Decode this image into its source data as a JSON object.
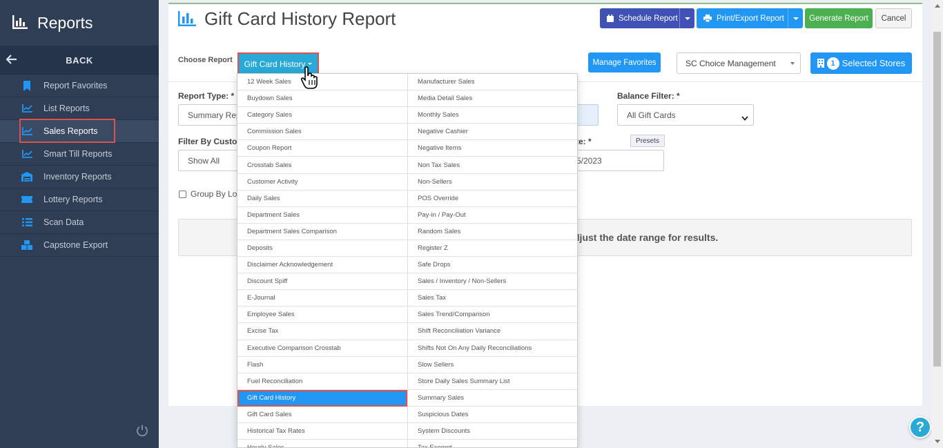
{
  "sidebar": {
    "title": "Reports",
    "back_label": "BACK",
    "items": [
      {
        "label": "Report Favorites",
        "icon": "bookmark-icon"
      },
      {
        "label": "List Reports",
        "icon": "chart-line-icon"
      },
      {
        "label": "Sales Reports",
        "icon": "chart-line-icon",
        "active": true
      },
      {
        "label": "Smart Till Reports",
        "icon": "chart-line-icon"
      },
      {
        "label": "Inventory Reports",
        "icon": "warehouse-icon"
      },
      {
        "label": "Lottery Reports",
        "icon": "ticket-icon"
      },
      {
        "label": "Scan Data",
        "icon": "list-icon"
      },
      {
        "label": "Capstone Export",
        "icon": "boxes-icon"
      }
    ]
  },
  "header": {
    "title": "Gift Card History Report",
    "schedule_label": "Schedule Report",
    "print_label": "Print/Export Report",
    "generate_label": "Generate Report",
    "cancel_label": "Cancel"
  },
  "choose": {
    "label": "Choose Report",
    "selected": "Gift Card History",
    "favorites_label": "Manage Favorites",
    "management": "SC Choice Management",
    "stores_count": "1",
    "stores_label": "Selected Stores"
  },
  "form": {
    "report_type_label": "Report Type: *",
    "report_type_value": "Summary Rep",
    "balance_label": "Balance Filter: *",
    "balance_value": "All Gift Cards",
    "filter_label": "Filter By Custom",
    "filter_value": "Show All",
    "date_label": "te: *",
    "date_value": "5/2023",
    "presets_label": "Presets",
    "group_label": "Group By Loc",
    "result_text": "djust the date range for results."
  },
  "menu": {
    "left": [
      "12 Week Sales",
      "Buydown Sales",
      "Category Sales",
      "Commission Sales",
      "Coupon Report",
      "Crosstab Sales",
      "Customer Activity",
      "Daily Sales",
      "Department Sales",
      "Department Sales Comparison",
      "Deposits",
      "Disclaimer Acknowledgement",
      "Discount Spiff",
      "E-Journal",
      "Employee Sales",
      "Excise Tax",
      "Executive Comparison Crosstab",
      "Flash",
      "Fuel Reconciliation",
      "Gift Card History",
      "Gift Card Sales",
      "Historical Tax Rates",
      "Hourly Sales"
    ],
    "right": [
      "Manufacturer Sales",
      "Media Detail Sales",
      "Monthly Sales",
      "Negative Cashier",
      "Negative Items",
      "Non Tax Sales",
      "Non-Sellers",
      "POS Override",
      "Pay-in / Pay-Out",
      "Random Sales",
      "Register Z",
      "Safe Drops",
      "Sales / Inventory / Non-Sellers",
      "Sales Tax",
      "Sales Trend/Comparison",
      "Shift Reconciliation Variance",
      "Shifts Not On Any Daily Reconciliations",
      "Slow Sellers",
      "Store Daily Sales Summary List",
      "Summary Sales",
      "Suspicious Dates",
      "System Discounts",
      "Tax Exempt"
    ],
    "selected_index": 19
  },
  "help_label": "?"
}
